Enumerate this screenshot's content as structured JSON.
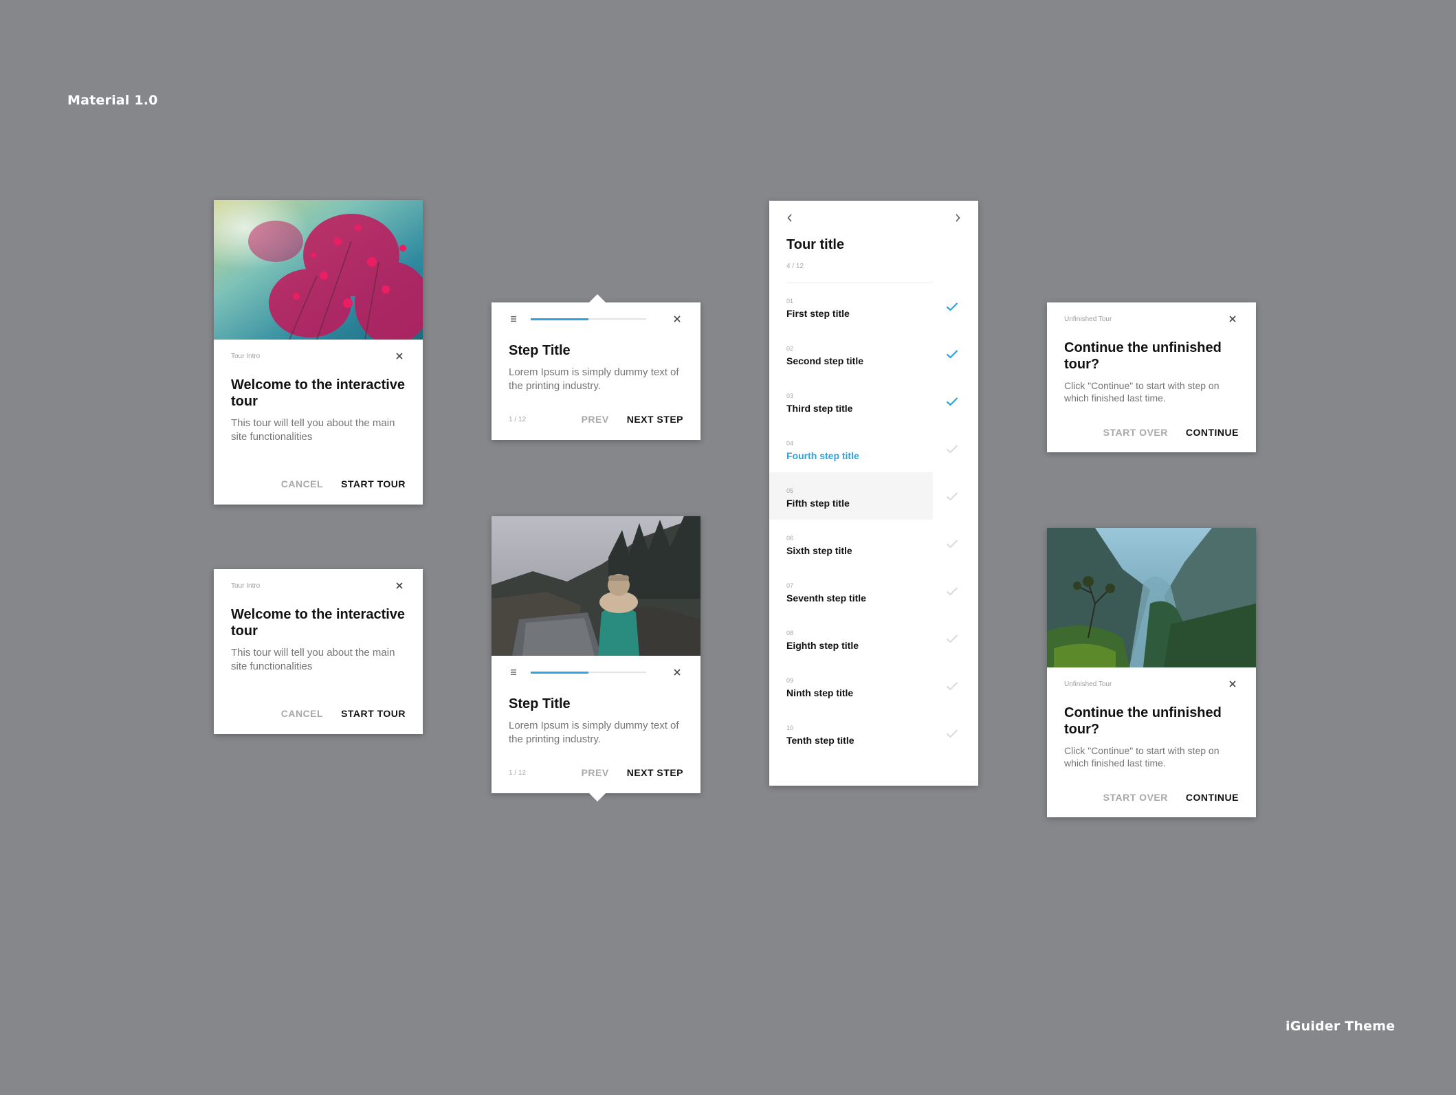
{
  "page": {
    "heading": "Material 1.0",
    "footer": "iGuider Theme"
  },
  "colors": {
    "background": "#86878b",
    "accent": "#2ba3e0",
    "muted_text": "#757575"
  },
  "intro_card": {
    "caption": "Tour Intro",
    "title": "Welcome to the interactive tour",
    "description": "This tour will tell you about the main site functionalities",
    "cancel_label": "CANCEL",
    "start_label": "START TOUR",
    "close_icon": "close-icon"
  },
  "step_card": {
    "title": "Step Title",
    "description": "Lorem Ipsum is simply dummy text of the printing industry.",
    "pager": "1 / 12",
    "prev_label": "PREV",
    "next_label": "NEXT STEP",
    "progress": 0.5,
    "menu_icon": "menu-icon"
  },
  "tour_list": {
    "title": "Tour title",
    "counter": "4 / 12",
    "items": [
      {
        "num": "01",
        "label": "First step title",
        "state": "done"
      },
      {
        "num": "02",
        "label": "Second step title",
        "state": "done"
      },
      {
        "num": "03",
        "label": "Third step title",
        "state": "done"
      },
      {
        "num": "04",
        "label": "Fourth step title",
        "state": "active"
      },
      {
        "num": "05",
        "label": "Fifth step title",
        "state": "hover"
      },
      {
        "num": "06",
        "label": "Sixth step title",
        "state": "pending"
      },
      {
        "num": "07",
        "label": "Seventh step title",
        "state": "pending"
      },
      {
        "num": "08",
        "label": "Eighth step title",
        "state": "pending"
      },
      {
        "num": "09",
        "label": "Ninth step title",
        "state": "pending"
      },
      {
        "num": "10",
        "label": "Tenth step title",
        "state": "pending"
      }
    ]
  },
  "unfinished_card": {
    "caption": "Unfinished Tour",
    "title": "Continue the unfinished tour?",
    "description": "Click \"Continue\" to start with step on which finished last time.",
    "start_over_label": "START OVER",
    "continue_label": "CONTINUE"
  }
}
